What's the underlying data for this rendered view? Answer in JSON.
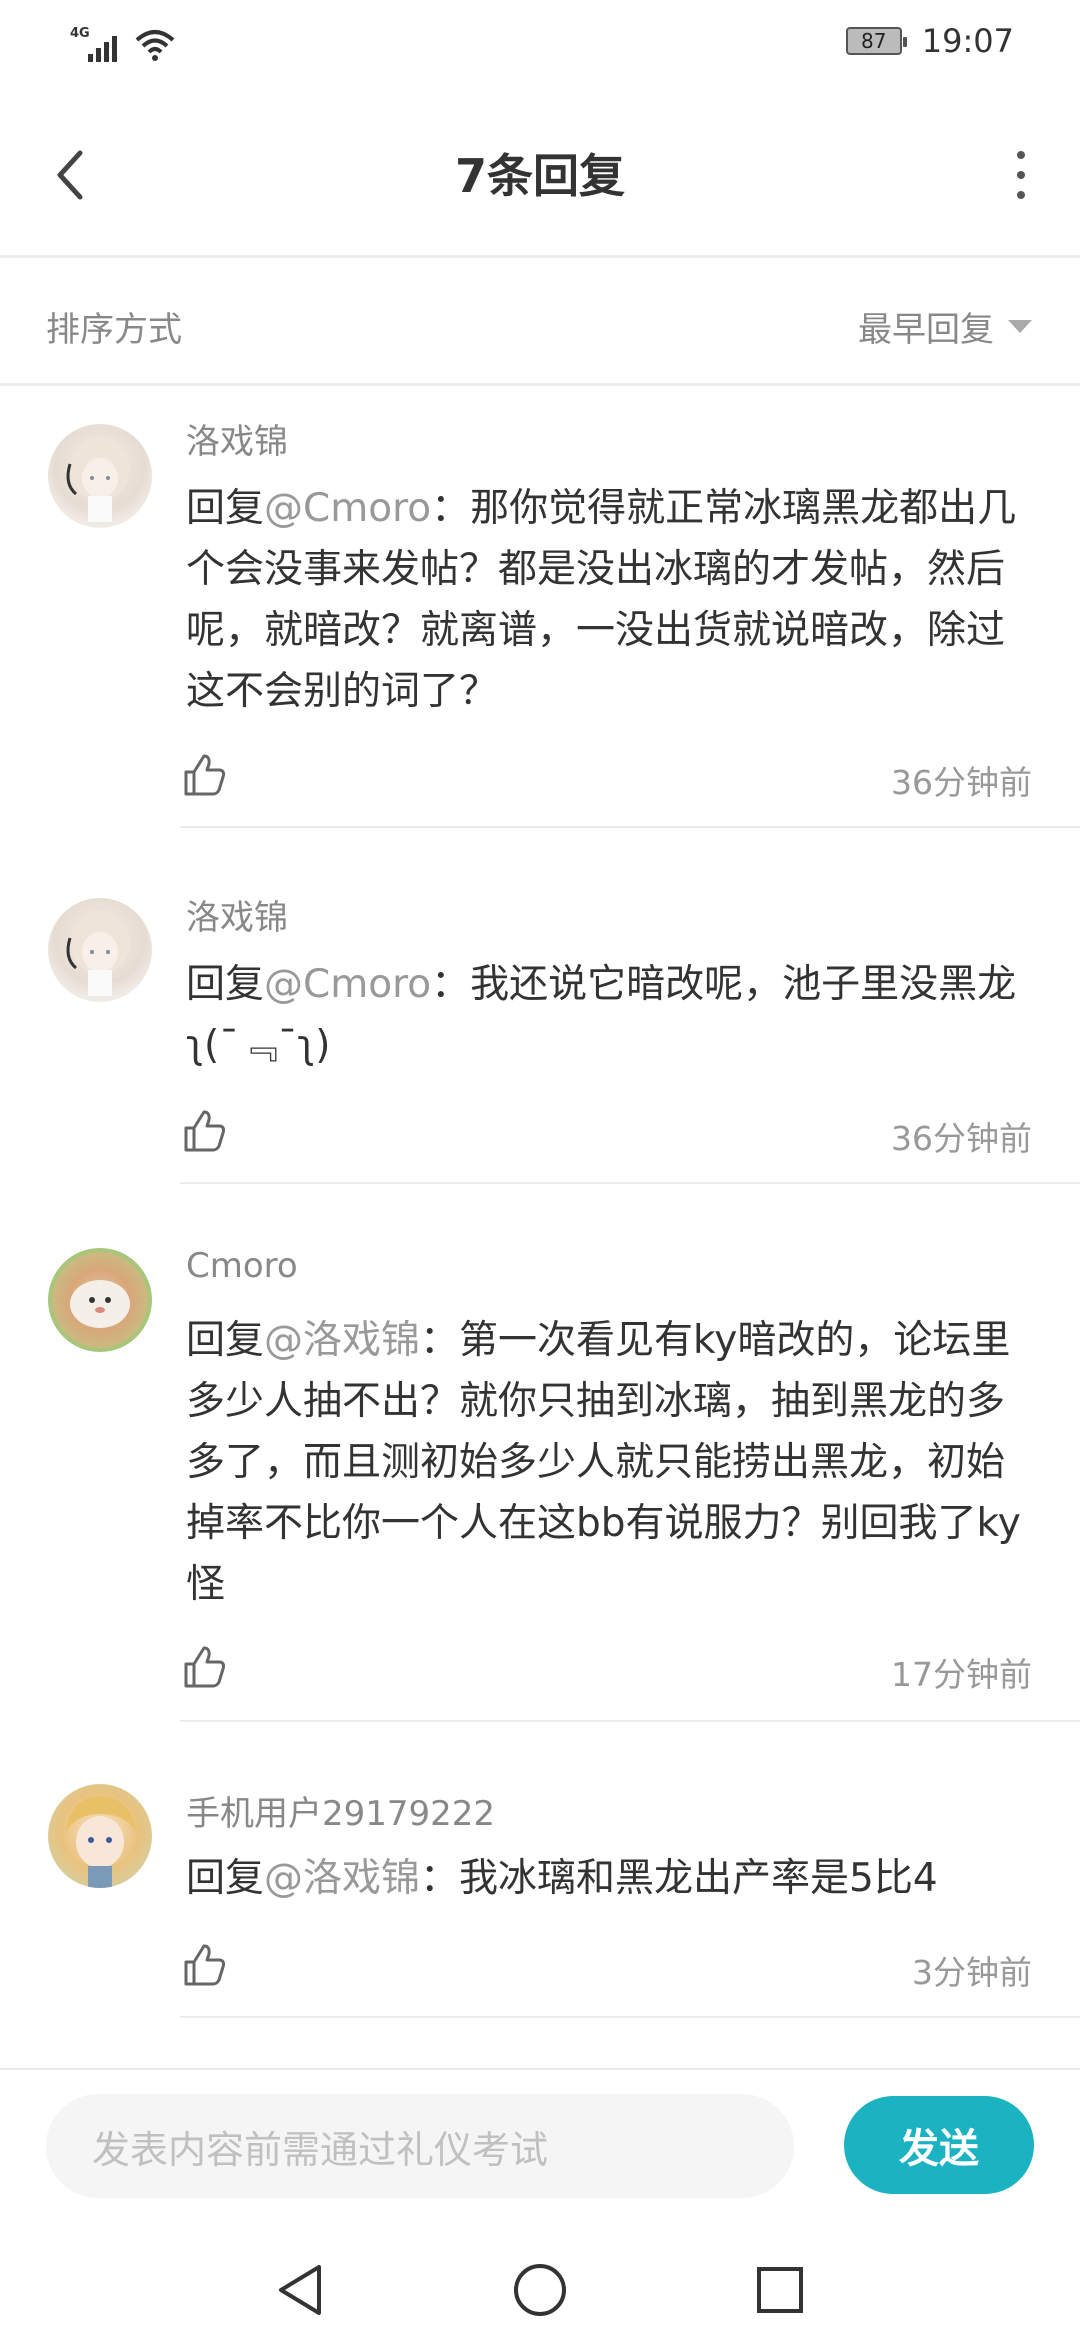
{
  "status_bar": {
    "network": "4G",
    "battery": "87",
    "time": "19:07"
  },
  "header": {
    "title": "7条回复"
  },
  "sort": {
    "label": "排序方式",
    "selected": "最早回复"
  },
  "replies": [
    {
      "username": "洛戏锦",
      "prefix": "回复",
      "mention": "@Cmoro",
      "separator": "：",
      "text": "那你觉得就正常冰璃黑龙都出几个会没事来发帖？都是没出冰璃的才发帖，然后呢，就暗改？就离谱，一没出货就说暗改，除过这不会别的词了？",
      "time": "36分钟前"
    },
    {
      "username": "洛戏锦",
      "prefix": "回复",
      "mention": "@Cmoro",
      "separator": "：",
      "text": "我还说它暗改呢，池子里没黑龙ʅ(¯﹃¯ʅ)",
      "time": "36分钟前"
    },
    {
      "username": "Cmoro",
      "prefix": "回复",
      "mention": "@洛戏锦",
      "separator": "：",
      "text": "第一次看见有ky暗改的，论坛里多少人抽不出？就你只抽到冰璃，抽到黑龙的多多了，而且测初始多少人就只能捞出黑龙，初始掉率不比你一个人在这bb有说服力？别回我了ky怪",
      "time": "17分钟前"
    },
    {
      "username": "手机用户29179222",
      "prefix": "回复",
      "mention": "@洛戏锦",
      "separator": "：",
      "text": "我冰璃和黑龙出产率是5比4",
      "time": "3分钟前"
    }
  ],
  "composer": {
    "placeholder": "发表内容前需通过礼仪考试",
    "send_label": "发送"
  },
  "colors": {
    "accent": "#1bb3c2",
    "muted_text": "#888888",
    "body_text": "#333333"
  },
  "icons": {
    "back": "chevron-left-icon",
    "more": "more-vertical-icon",
    "like": "thumbs-up-icon",
    "nav_back": "triangle-back-icon",
    "nav_home": "circle-home-icon",
    "nav_recent": "square-recent-icon"
  }
}
